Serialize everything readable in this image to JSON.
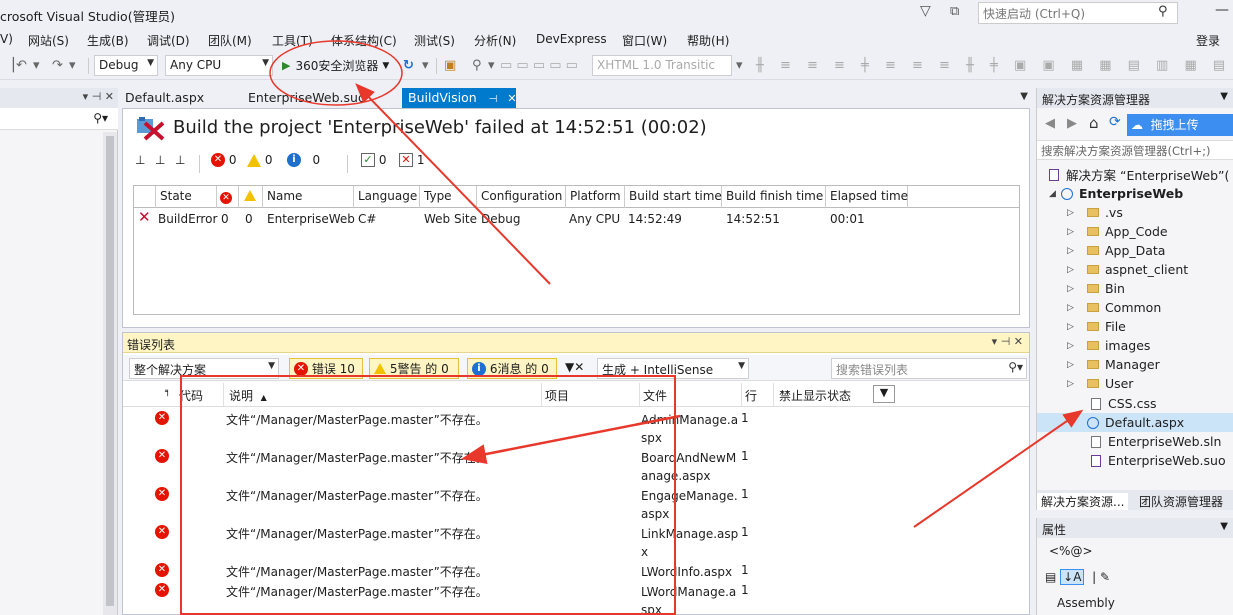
{
  "window": {
    "title": "crosoft Visual Studio(管理员)",
    "quick_launch_placeholder": "快速启动 (Ctrl+Q)"
  },
  "menu": {
    "items": [
      "V)",
      "网站(S)",
      "生成(B)",
      "调试(D)",
      "团队(M)",
      "工具(T)",
      "体系结构(C)",
      "测试(S)",
      "分析(N)",
      "DevExpress",
      "窗口(W)",
      "帮助(H)"
    ],
    "login": "登录"
  },
  "toolbar": {
    "config": "Debug",
    "platform": "Any CPU",
    "run_label": "360安全浏览器",
    "xhtml": "XHTML 1.0 Transitic"
  },
  "tabs": [
    {
      "label": "Default.aspx"
    },
    {
      "label": "EnterpriseWeb.suo"
    },
    {
      "label": "BuildVision"
    }
  ],
  "buildvision": {
    "title": "Build the project 'EnterpriseWeb' failed at 14:52:51 (00:02)",
    "counts": {
      "errors": "0",
      "warnings": "0",
      "messages": "0",
      "succeeded": "0",
      "failed": "1"
    },
    "columns": [
      "State",
      "",
      "",
      "Name",
      "Language",
      "Type",
      "Configuration",
      "Platform",
      "Build start time",
      "Build finish time",
      "Elapsed time"
    ],
    "row": {
      "state": "BuildError",
      "err": "0",
      "warn": "0",
      "name": "EnterpriseWeb",
      "language": "C#",
      "type": "Web Site",
      "configuration": "Debug",
      "platform": "Any CPU",
      "start": "14:52:49",
      "finish": "14:52:51",
      "elapsed": "00:01"
    }
  },
  "errorlist": {
    "title": "错误列表",
    "scope": "整个解决方案",
    "errors_btn": "错误 10",
    "warnings_btn": "5警告 的 0",
    "messages_btn": "6消息 的 0",
    "build_filter": "生成 + IntelliSense",
    "search_placeholder": "搜索错误列表",
    "columns": {
      "code": "代码",
      "desc": "说明",
      "project": "项目",
      "file": "文件",
      "line": "行",
      "suppress": "禁止显示状态"
    },
    "rows": [
      {
        "desc": "文件“/Manager/MasterPage.master”不存在。",
        "file": "AdminManage.aspx",
        "line": "1"
      },
      {
        "desc": "文件“/Manager/MasterPage.master”不存在。",
        "file": "BoardAndNewManage.aspx",
        "line": "1"
      },
      {
        "desc": "文件“/Manager/MasterPage.master”不存在。",
        "file": "EngageManage.aspx",
        "line": "1"
      },
      {
        "desc": "文件“/Manager/MasterPage.master”不存在。",
        "file": "LinkManage.aspx",
        "line": "1"
      },
      {
        "desc": "文件“/Manager/MasterPage.master”不存在。",
        "file": "LWordInfo.aspx",
        "line": "1"
      },
      {
        "desc": "文件“/Manager/MasterPage.master”不存在。",
        "file": "LWordManage.aspx",
        "line": "1"
      }
    ]
  },
  "solution": {
    "title": "解决方案资源管理器",
    "upload": "拖拽上传",
    "search_placeholder": "搜索解决方案资源管理器(Ctrl+;)",
    "root": "解决方案 “EnterpriseWeb”(",
    "project": "EnterpriseWeb",
    "folders": [
      ".vs",
      "App_Code",
      "App_Data",
      "aspnet_client",
      "Bin",
      "Common",
      "File",
      "images",
      "Manager",
      "User"
    ],
    "files": [
      "CSS.css",
      "Default.aspx",
      "EnterpriseWeb.sln",
      "EnterpriseWeb.suo"
    ],
    "tab1": "解决方案资源...",
    "tab2": "团队资源管理器"
  },
  "properties": {
    "title": "属性",
    "object": "<%@>",
    "assembly": "Assembly"
  }
}
